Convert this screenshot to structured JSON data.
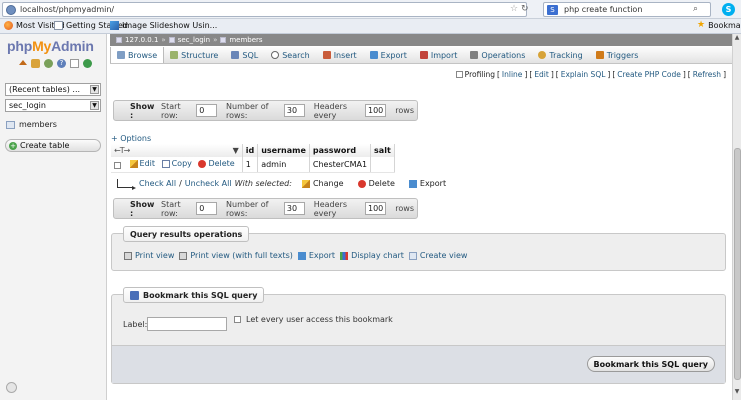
{
  "browser": {
    "url": "localhost/phpmyadmin/",
    "search_engine_icon": "S",
    "search_value": "php create function",
    "bookmarks_bar": [
      "Most Visited",
      "Getting Started",
      "Image Slideshow Usin..."
    ],
    "bookmarks_menu": "Bookmarks"
  },
  "logo": {
    "php": "php",
    "my": "My",
    "admin": "Admin"
  },
  "leftnav": {
    "recent_tables": "(Recent tables) ...",
    "database": "sec_login",
    "tables": [
      "members"
    ],
    "create_table": "Create table"
  },
  "breadcrumb": {
    "server": "127.0.0.1",
    "database": "sec_login",
    "table": "members",
    "separator": "»"
  },
  "tabs": [
    {
      "label": "Browse",
      "icon": "browse-icon"
    },
    {
      "label": "Structure",
      "icon": "structure-icon"
    },
    {
      "label": "SQL",
      "icon": "sql-icon"
    },
    {
      "label": "Search",
      "icon": "search-icon"
    },
    {
      "label": "Insert",
      "icon": "insert-icon"
    },
    {
      "label": "Export",
      "icon": "export-icon"
    },
    {
      "label": "Import",
      "icon": "import-icon"
    },
    {
      "label": "Operations",
      "icon": "operations-icon"
    },
    {
      "label": "Tracking",
      "icon": "tracking-icon"
    },
    {
      "label": "Triggers",
      "icon": "triggers-icon"
    }
  ],
  "profiling": {
    "label": "Profiling",
    "links": [
      "Inline",
      "Edit",
      "Explain SQL",
      "Create PHP Code",
      "Refresh"
    ]
  },
  "navigation": {
    "show": "Show :",
    "start_row_label": "Start row:",
    "start_row": "0",
    "num_rows_label": "Number of rows:",
    "num_rows": "30",
    "headers_label": "Headers every",
    "headers": "100",
    "rows_suffix": "rows"
  },
  "options_link": "+ Options",
  "table": {
    "arrows": "←T→",
    "sort_indicator": "▼",
    "columns": [
      "id",
      "username",
      "password",
      "salt"
    ],
    "actions": {
      "edit": "Edit",
      "copy": "Copy",
      "delete": "Delete"
    },
    "rows": [
      {
        "id": "1",
        "username": "admin",
        "password": "ChesterCMA1",
        "salt": ""
      }
    ]
  },
  "with_selected": {
    "check_all": "Check All",
    "separator": "/",
    "uncheck_all": "Uncheck All",
    "label": "With selected:",
    "change": "Change",
    "delete": "Delete",
    "export": "Export"
  },
  "query_ops": {
    "legend": "Query results operations",
    "print_view": "Print view",
    "print_full": "Print view (with full texts)",
    "export": "Export",
    "display_chart": "Display chart",
    "create_view": "Create view"
  },
  "bookmark": {
    "legend": "Bookmark this SQL query",
    "label": "Label:",
    "label_value": "",
    "public_checkbox": "Let every user access this bookmark",
    "submit": "Bookmark this SQL query"
  }
}
